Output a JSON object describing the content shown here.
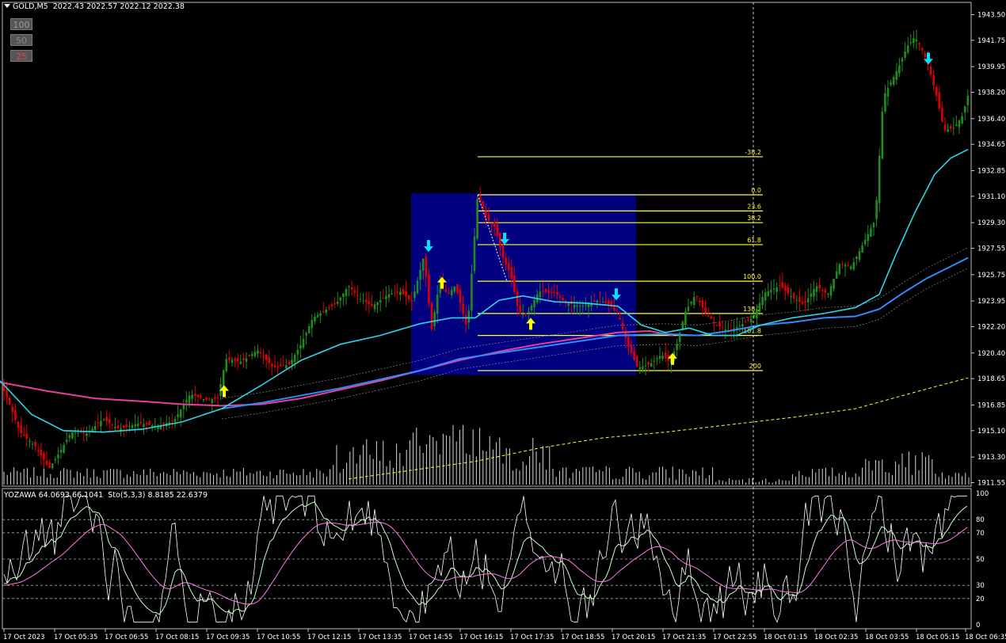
{
  "header": {
    "symbol": "GOLD,M5",
    "ohlc": "2022.43 2022.57 2022.12 2022.38"
  },
  "indicator_header": {
    "text": "YOZAWA 64.0693 66.1041  Sto(5,3,3) 8.8185 22.6379"
  },
  "zoom_buttons": [
    "100",
    "50",
    "25"
  ],
  "colors": {
    "background": "#000000",
    "bull": "#1f8c1f",
    "bear": "#e00000",
    "fib": "#ffff33",
    "fib_box": "#000080",
    "ma_fast": "#2ad6e8",
    "ma_slow": "#2f8cff",
    "ma_long": "#e8409a",
    "volume": "#d8d8d8",
    "stoch_main": "#c8ffc8",
    "stoch_signal": "#ff7ce8",
    "oscillator": "#ffffff",
    "arrow_up": "#ffff00",
    "arrow_down": "#00e5ff"
  },
  "chart_data": {
    "type": "candlestick",
    "symbol": "GOLD",
    "timeframe": "M5",
    "y_ticks": [
      "1943.50",
      "1941.75",
      "1939.95",
      "1938.20",
      "1936.40",
      "1934.65",
      "1932.85",
      "1931.10",
      "1929.30",
      "1927.55",
      "1925.75",
      "1923.95",
      "1922.20",
      "1920.40",
      "1918.65",
      "1916.85",
      "1915.10",
      "1913.30",
      "1911.55"
    ],
    "ylim": [
      1911.55,
      1943.5
    ],
    "x_ticks": [
      "17 Oct 2023",
      "17 Oct 05:35",
      "17 Oct 06:55",
      "17 Oct 08:15",
      "17 Oct 09:35",
      "17 Oct 10:55",
      "17 Oct 12:15",
      "17 Oct 13:35",
      "17 Oct 14:55",
      "17 Oct 16:15",
      "17 Oct 17:35",
      "17 Oct 18:55",
      "17 Oct 20:15",
      "17 Oct 21:35",
      "17 Oct 22:55",
      "18 Oct 01:15",
      "18 Oct 02:35",
      "18 Oct 03:55",
      "18 Oct 05:15",
      "18 Oct 06:35"
    ],
    "price_path": [
      [
        0,
        1918.4
      ],
      [
        10,
        1917.2
      ],
      [
        25,
        1915.0
      ],
      [
        45,
        1914.0
      ],
      [
        62,
        1912.5
      ],
      [
        75,
        1913.6
      ],
      [
        90,
        1915.0
      ],
      [
        110,
        1914.9
      ],
      [
        130,
        1915.9
      ],
      [
        150,
        1915.2
      ],
      [
        175,
        1915.6
      ],
      [
        200,
        1915.4
      ],
      [
        220,
        1915.8
      ],
      [
        240,
        1917.6
      ],
      [
        260,
        1917.2
      ],
      [
        275,
        1917.3
      ],
      [
        285,
        1920.0
      ],
      [
        305,
        1919.8
      ],
      [
        325,
        1920.6
      ],
      [
        345,
        1919.4
      ],
      [
        365,
        1919.6
      ],
      [
        380,
        1921.0
      ],
      [
        395,
        1922.8
      ],
      [
        410,
        1923.3
      ],
      [
        425,
        1923.8
      ],
      [
        440,
        1925.0
      ],
      [
        455,
        1924.1
      ],
      [
        470,
        1923.6
      ],
      [
        490,
        1924.4
      ],
      [
        505,
        1924.6
      ],
      [
        520,
        1923.9
      ],
      [
        535,
        1927.0
      ],
      [
        545,
        1922.0
      ],
      [
        555,
        1925.3
      ],
      [
        565,
        1924.4
      ],
      [
        575,
        1925.0
      ],
      [
        590,
        1922.0
      ],
      [
        603,
        1931.2
      ],
      [
        615,
        1929.5
      ],
      [
        625,
        1929.0
      ],
      [
        635,
        1926.9
      ],
      [
        645,
        1925.7
      ],
      [
        655,
        1923.1
      ],
      [
        665,
        1923.0
      ],
      [
        680,
        1924.6
      ],
      [
        700,
        1924.5
      ],
      [
        715,
        1923.8
      ],
      [
        735,
        1923.6
      ],
      [
        755,
        1924.0
      ],
      [
        770,
        1923.7
      ],
      [
        782,
        1922.8
      ],
      [
        792,
        1921.0
      ],
      [
        805,
        1919.4
      ],
      [
        820,
        1919.6
      ],
      [
        835,
        1920.3
      ],
      [
        845,
        1919.8
      ],
      [
        853,
        1920.7
      ],
      [
        865,
        1923.2
      ],
      [
        878,
        1924.4
      ],
      [
        890,
        1923.2
      ],
      [
        905,
        1922.3
      ],
      [
        920,
        1921.9
      ],
      [
        935,
        1922.3
      ],
      [
        950,
        1922.8
      ],
      [
        965,
        1924.5
      ],
      [
        985,
        1925.0
      ],
      [
        1000,
        1924.2
      ],
      [
        1015,
        1923.7
      ],
      [
        1030,
        1925.0
      ],
      [
        1045,
        1924.4
      ],
      [
        1060,
        1926.5
      ],
      [
        1075,
        1926.3
      ],
      [
        1090,
        1927.9
      ],
      [
        1105,
        1929.5
      ],
      [
        1115,
        1937.9
      ],
      [
        1125,
        1938.9
      ],
      [
        1135,
        1940.0
      ],
      [
        1145,
        1941.3
      ],
      [
        1155,
        1942.0
      ],
      [
        1165,
        1941.0
      ],
      [
        1172,
        1940.0
      ],
      [
        1182,
        1938.0
      ],
      [
        1192,
        1935.6
      ],
      [
        1205,
        1935.8
      ],
      [
        1215,
        1936.6
      ],
      [
        1222,
        1938.0
      ]
    ],
    "ma_fast_path": [
      [
        0,
        1918.5
      ],
      [
        40,
        1916.2
      ],
      [
        80,
        1915.1
      ],
      [
        130,
        1915.0
      ],
      [
        180,
        1915.2
      ],
      [
        230,
        1915.7
      ],
      [
        280,
        1916.6
      ],
      [
        330,
        1918.2
      ],
      [
        380,
        1919.9
      ],
      [
        430,
        1921.0
      ],
      [
        480,
        1921.6
      ],
      [
        530,
        1922.4
      ],
      [
        570,
        1922.8
      ],
      [
        600,
        1922.8
      ],
      [
        630,
        1924.0
      ],
      [
        660,
        1924.3
      ],
      [
        700,
        1923.9
      ],
      [
        740,
        1923.8
      ],
      [
        780,
        1923.6
      ],
      [
        810,
        1922.3
      ],
      [
        840,
        1921.8
      ],
      [
        870,
        1922.1
      ],
      [
        900,
        1921.6
      ],
      [
        930,
        1921.6
      ],
      [
        960,
        1922.3
      ],
      [
        1000,
        1922.8
      ],
      [
        1040,
        1923.1
      ],
      [
        1080,
        1923.5
      ],
      [
        1110,
        1924.4
      ],
      [
        1130,
        1927.0
      ],
      [
        1155,
        1930.0
      ],
      [
        1180,
        1932.6
      ],
      [
        1200,
        1933.7
      ],
      [
        1222,
        1934.3
      ]
    ],
    "ma_slow_path": [
      [
        280,
        1916.6
      ],
      [
        330,
        1917.0
      ],
      [
        380,
        1917.5
      ],
      [
        430,
        1918.0
      ],
      [
        480,
        1918.6
      ],
      [
        530,
        1919.2
      ],
      [
        580,
        1920.0
      ],
      [
        630,
        1920.4
      ],
      [
        680,
        1920.8
      ],
      [
        730,
        1921.2
      ],
      [
        780,
        1921.6
      ],
      [
        840,
        1921.7
      ],
      [
        880,
        1921.6
      ],
      [
        920,
        1921.9
      ],
      [
        960,
        1922.3
      ],
      [
        1000,
        1922.5
      ],
      [
        1040,
        1922.8
      ],
      [
        1080,
        1922.9
      ],
      [
        1110,
        1923.4
      ],
      [
        1140,
        1924.5
      ],
      [
        1170,
        1925.5
      ],
      [
        1200,
        1926.3
      ],
      [
        1222,
        1926.9
      ]
    ],
    "ma_long_path": [
      [
        0,
        1918.4
      ],
      [
        60,
        1917.8
      ],
      [
        120,
        1917.3
      ],
      [
        180,
        1917.1
      ],
      [
        230,
        1916.9
      ],
      [
        280,
        1916.8
      ],
      [
        330,
        1916.9
      ],
      [
        380,
        1917.3
      ],
      [
        430,
        1917.9
      ],
      [
        480,
        1918.5
      ],
      [
        530,
        1919.2
      ],
      [
        580,
        1919.9
      ],
      [
        630,
        1920.5
      ],
      [
        680,
        1921.0
      ],
      [
        730,
        1921.4
      ],
      [
        780,
        1921.8
      ],
      [
        820,
        1921.9
      ],
      [
        850,
        1921.6
      ]
    ],
    "ma_dotted_path": [
      [
        440,
        1911.8
      ],
      [
        520,
        1912.4
      ],
      [
        600,
        1913.0
      ],
      [
        680,
        1913.9
      ],
      [
        760,
        1914.6
      ],
      [
        840,
        1915.0
      ],
      [
        920,
        1915.5
      ],
      [
        1000,
        1916.0
      ],
      [
        1080,
        1916.6
      ],
      [
        1160,
        1917.8
      ],
      [
        1222,
        1918.7
      ]
    ],
    "fibonacci": {
      "levels": [
        {
          "label": "-38.2",
          "price": 1933.8
        },
        {
          "label": "0.0",
          "price": 1931.2
        },
        {
          "label": "23.6",
          "price": 1930.1
        },
        {
          "label": "38.2",
          "price": 1929.3
        },
        {
          "label": "61.8",
          "price": 1927.8
        },
        {
          "label": "100.0",
          "price": 1925.3
        },
        {
          "label": "138.2",
          "price": 1923.1
        },
        {
          "label": "161.8",
          "price": 1921.6
        },
        {
          "label": "200",
          "price": 1919.2
        }
      ],
      "box_time_range": [
        "17 Oct 14:55",
        "17 Oct 20:15"
      ],
      "box_price_range": [
        1918.9,
        1931.3
      ]
    },
    "signals": [
      {
        "type": "up",
        "x": 283,
        "price": 1918.2
      },
      {
        "type": "down",
        "x": 541,
        "price": 1927.3
      },
      {
        "type": "up",
        "x": 558,
        "price": 1925.6
      },
      {
        "type": "down",
        "x": 637,
        "price": 1927.8
      },
      {
        "type": "up",
        "x": 670,
        "price": 1922.8
      },
      {
        "type": "down",
        "x": 778,
        "price": 1924.0
      },
      {
        "type": "up",
        "x": 849,
        "price": 1920.4
      },
      {
        "type": "down",
        "x": 1172,
        "price": 1940.1
      }
    ],
    "current_time_marker": "18 Oct 01:15",
    "oscillator": {
      "ylim": [
        0,
        100
      ],
      "levels": [
        100,
        80,
        70,
        50,
        30,
        20,
        0
      ],
      "dashed_levels": [
        80,
        70,
        50,
        30,
        20
      ]
    }
  }
}
